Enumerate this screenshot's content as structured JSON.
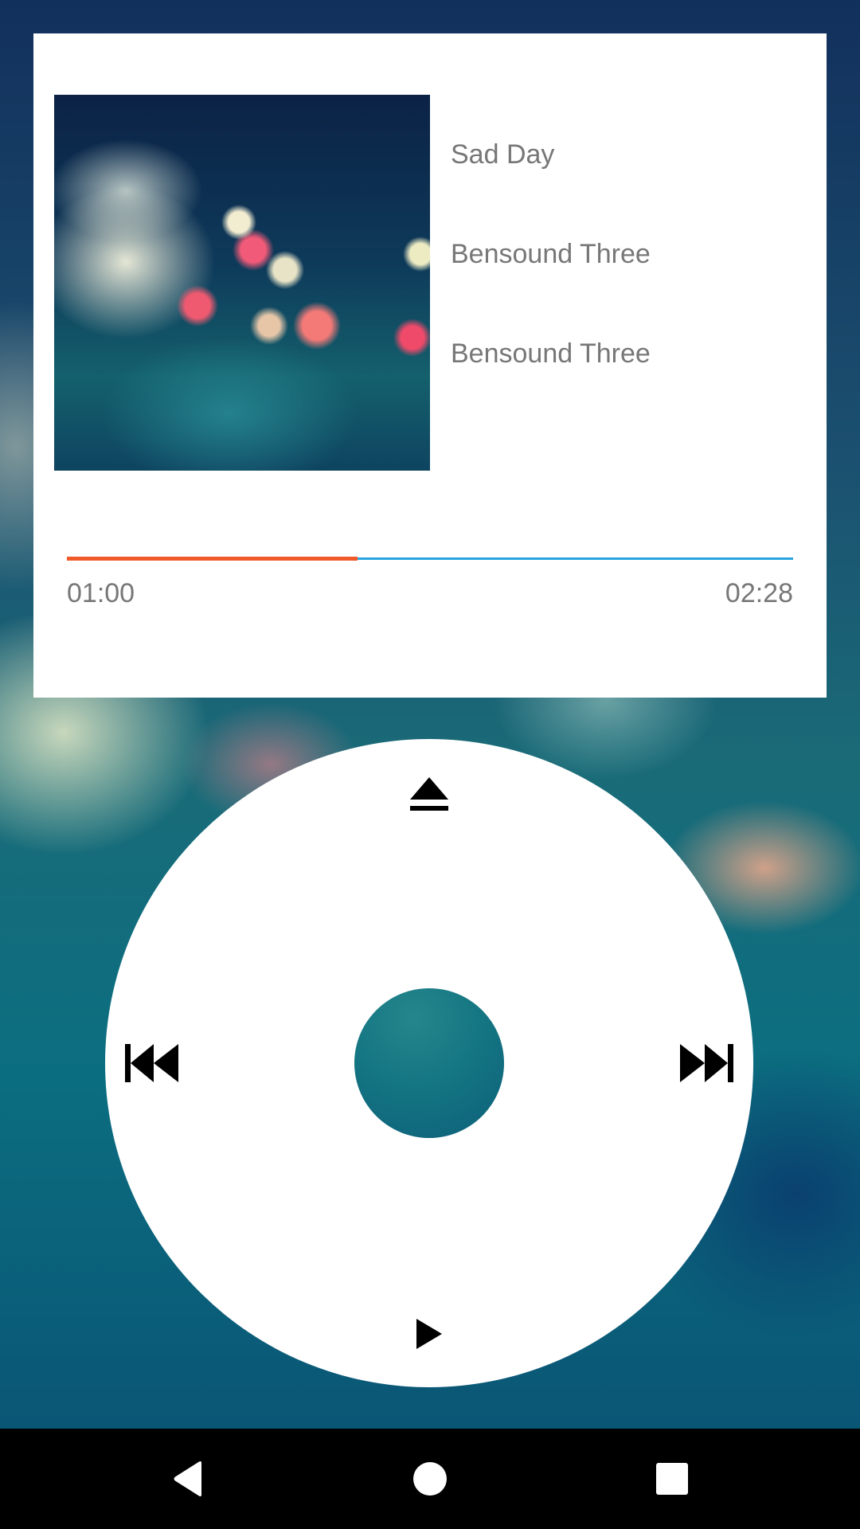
{
  "track": {
    "title": "Sad Day",
    "artist": "Bensound Three",
    "album": "Bensound Three"
  },
  "playback": {
    "current_time": "01:00",
    "total_time": "02:28",
    "progress_fraction": 0.4
  },
  "controls": {
    "top_icon": "eject-icon",
    "left_icon": "skip-previous-icon",
    "right_icon": "skip-next-icon",
    "bottom_icon": "play-icon"
  },
  "navbar": {
    "icons": [
      "back-icon",
      "home-icon",
      "recents-icon"
    ]
  },
  "colors": {
    "progress_played": "#f05a2a",
    "progress_remaining": "#29a3e0",
    "center_button": "#147682",
    "card_background": "#ffffff"
  }
}
